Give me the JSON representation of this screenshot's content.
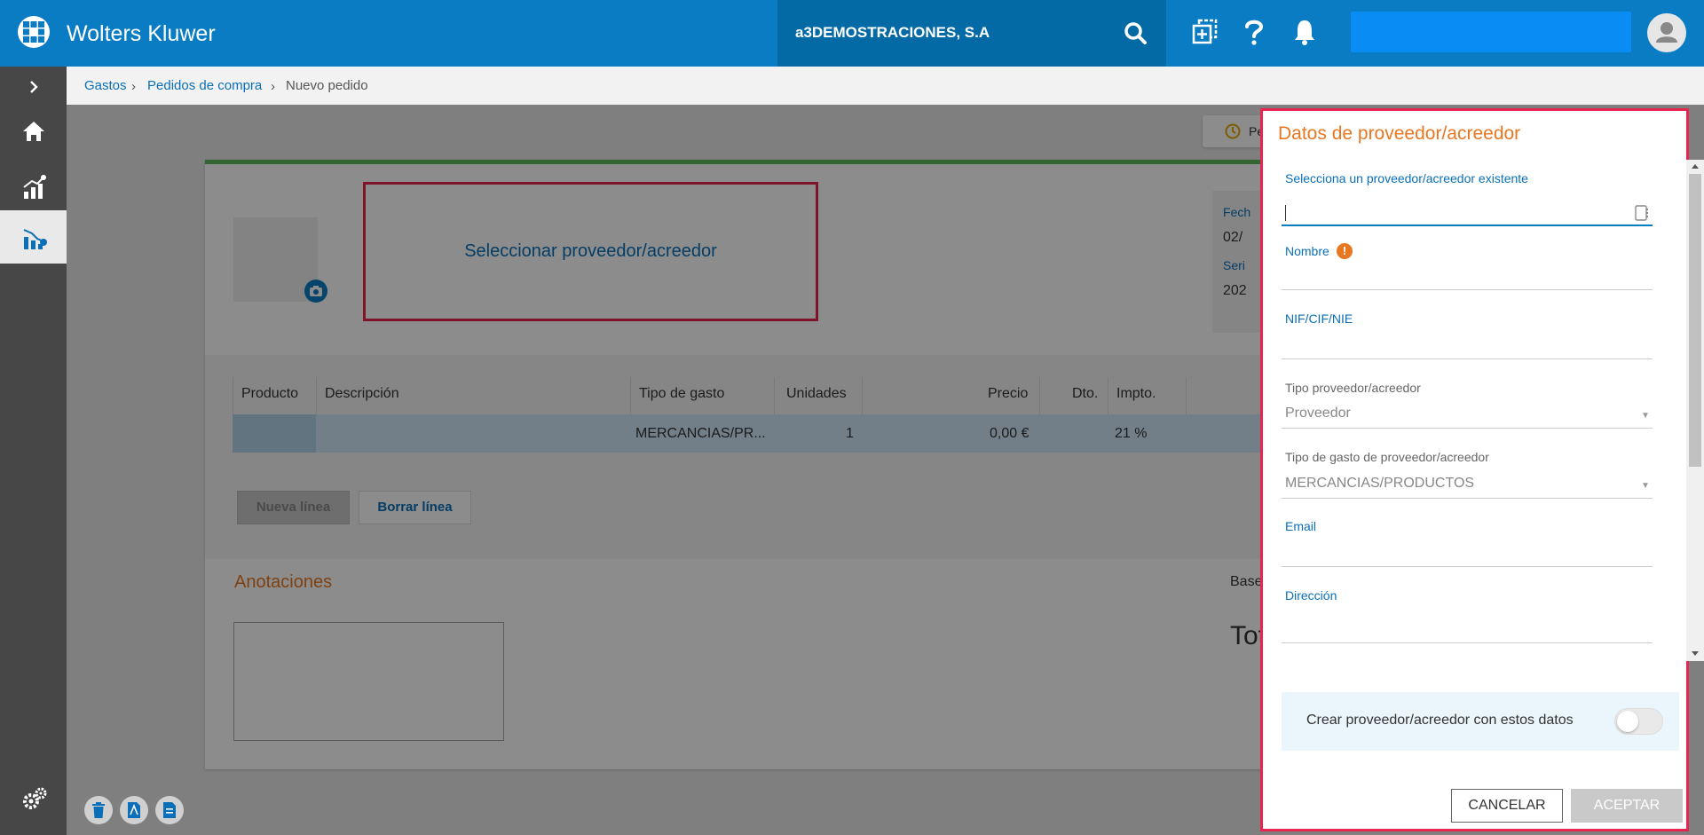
{
  "app": {
    "brand": "Wolters Kluwer",
    "company": "a3DEMOSTRACIONES, S.A"
  },
  "breadcrumb": {
    "items": [
      "Gastos",
      "Pedidos de compra",
      "Nuevo pedido"
    ]
  },
  "order": {
    "pending_chip": "Pe",
    "select_supplier": "Seleccionar proveedor/acreedor",
    "date_label": "Fech",
    "date_value": "02/",
    "series_label": "Seri",
    "series_value": "202"
  },
  "lines_table": {
    "headers": [
      "Producto",
      "Descripción",
      "Tipo de gasto",
      "Unidades",
      "Precio",
      "Dto.",
      "Impto."
    ],
    "row": {
      "producto": "",
      "descripcion": "",
      "tipo_gasto": "MERCANCIAS/PR...",
      "unidades": "1",
      "precio": "0,00 €",
      "dto": "",
      "impto": "21 %"
    }
  },
  "actions": {
    "new_line": "Nueva línea",
    "delete_line": "Borrar línea"
  },
  "annotations": {
    "title": "Anotaciones"
  },
  "totals": {
    "base_label": "Base",
    "total_label": "Tot"
  },
  "panel": {
    "title": "Datos de proveedor/acreedor",
    "existing_label": "Selecciona un proveedor/acreedor existente",
    "existing_value": "",
    "name_label": "Nombre",
    "nif_label": "NIF/CIF/NIE",
    "type_label": "Tipo proveedor/acreedor",
    "type_value": "Proveedor",
    "expense_type_label": "Tipo de gasto de proveedor/acreedor",
    "expense_type_value": "MERCANCIAS/PRODUCTOS",
    "email_label": "Email",
    "address_label": "Dirección",
    "create_label": "Crear proveedor/acreedor con estos datos",
    "cancel": "CANCELAR",
    "accept": "ACEPTAR"
  },
  "colors": {
    "brand": "#0a7cc4",
    "accent_orange": "#e87722",
    "highlight": "#e8254e"
  }
}
